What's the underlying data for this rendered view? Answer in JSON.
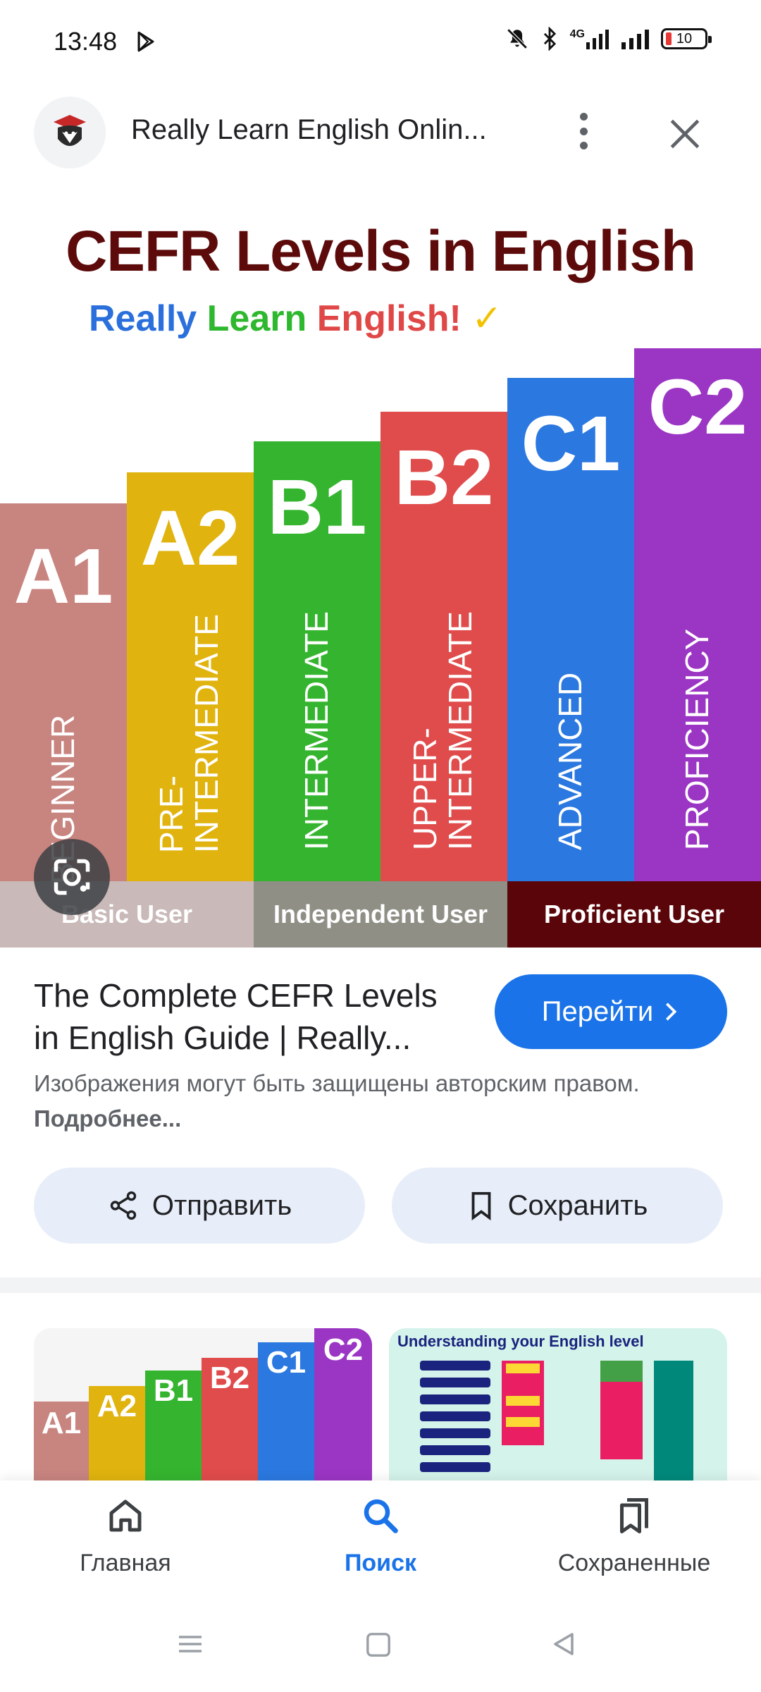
{
  "status_bar": {
    "time": "13:48",
    "network": "4G",
    "battery": "10"
  },
  "header": {
    "site_name": "Really Learn English Onlin..."
  },
  "hero": {
    "title": "CEFR Levels in English",
    "subtitle": {
      "w1": "Really",
      "w2": "Learn",
      "w3": "English!",
      "w4": "✓"
    },
    "levels": [
      {
        "code": "A1",
        "label": "BEGINNER",
        "color": "#c8847f"
      },
      {
        "code": "A2",
        "label": "PRE-\nINTERMEDIATE",
        "color": "#e0b30e"
      },
      {
        "code": "B1",
        "label": "INTERMEDIATE",
        "color": "#35b52f"
      },
      {
        "code": "B2",
        "label": "UPPER-\nINTERMEDIATE",
        "color": "#e04b4b"
      },
      {
        "code": "C1",
        "label": "ADVANCED",
        "color": "#2a78e0"
      },
      {
        "code": "C2",
        "label": "PROFICIENCY",
        "color": "#9b35c4"
      }
    ],
    "bands": [
      {
        "label": "Basic User",
        "color": "#c9b9b8"
      },
      {
        "label": "Independent User",
        "color": "#8f8f86"
      },
      {
        "label": "Proficient User",
        "color": "#5a0509"
      }
    ]
  },
  "result": {
    "title": "The Complete CEFR Levels in English Guide | Really...",
    "go_label": "Перейти",
    "copyright_text": "Изображения могут быть защищены авторским правом.",
    "more_label": "Подробнее..."
  },
  "actions": {
    "share_label": "Отправить",
    "save_label": "Сохранить"
  },
  "related": {
    "thumb1_codes": [
      "A1",
      "A2",
      "B1",
      "B2",
      "C1",
      "C2"
    ],
    "thumb2_title": "Understanding your English level"
  },
  "bottom_nav": {
    "home": "Главная",
    "search": "Поиск",
    "saved": "Сохраненные"
  },
  "colors": {
    "accent": "#1a73e8",
    "chip_bg": "#e8eef9"
  }
}
